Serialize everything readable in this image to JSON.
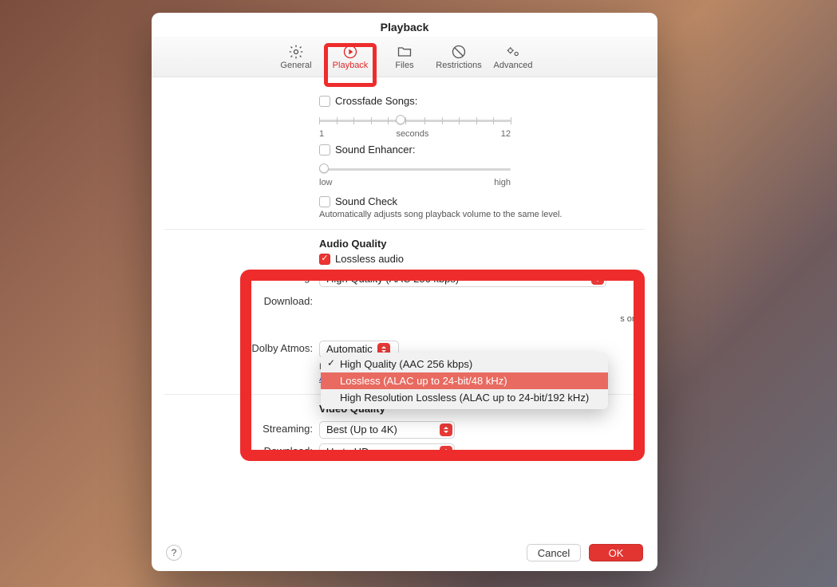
{
  "window": {
    "title": "Playback"
  },
  "tabs": {
    "general": {
      "label": "General"
    },
    "playback": {
      "label": "Playback"
    },
    "files": {
      "label": "Files"
    },
    "restrictions": {
      "label": "Restrictions"
    },
    "advanced": {
      "label": "Advanced"
    }
  },
  "crossfade": {
    "label": "Crossfade Songs:",
    "min_label": "1",
    "unit_label": "seconds",
    "max_label": "12"
  },
  "enhancer": {
    "label": "Sound Enhancer:",
    "low_label": "low",
    "high_label": "high"
  },
  "sound_check": {
    "label": "Sound Check",
    "hint": "Automatically adjusts song playback volume to the same level."
  },
  "audio_quality": {
    "heading": "Audio Quality",
    "lossless_label": "Lossless audio",
    "streaming_label": "Streaming:",
    "streaming_value": "High Quality (AAC 256 kbps)",
    "download_label": "Download:",
    "download_options": {
      "o0": "High Quality (AAC 256 kbps)",
      "o1": "Lossless (ALAC up to 24-bit/48 kHz)",
      "o2": "High Resolution Lossless (ALAC up to 24-bit/192 kHz)"
    },
    "truncated_suffix": "s on",
    "dolby_label": "Dolby Atmos:",
    "dolby_value": "Automatic",
    "dolby_hint": "Play supported songs in Dolby Atmos and other Dolby Audio formats.",
    "dolby_link": "About Dolby Atmos."
  },
  "video_quality": {
    "heading": "Video Quality",
    "streaming_label": "Streaming:",
    "streaming_value": "Best (Up to 4K)",
    "download_label": "Download:",
    "download_value": "Up to HD"
  },
  "footer": {
    "help": "?",
    "cancel": "Cancel",
    "ok": "OK"
  }
}
